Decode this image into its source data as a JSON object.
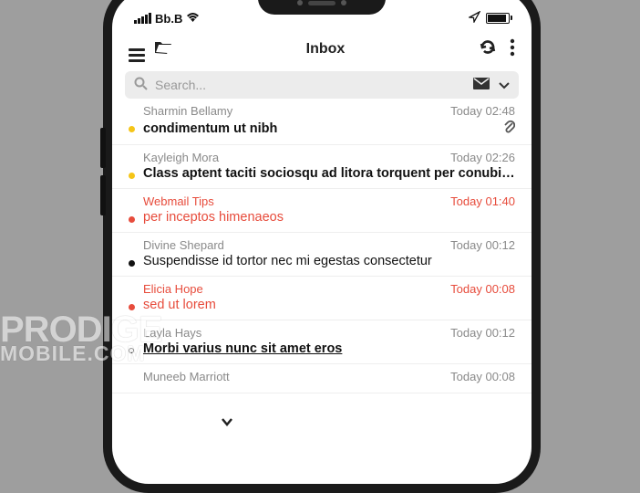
{
  "statusbar": {
    "carrier": "Bb.B"
  },
  "toolbar": {
    "title": "Inbox"
  },
  "search": {
    "placeholder": "Search..."
  },
  "emails": [
    {
      "sender": "Sharmin Bellamy",
      "time": "Today 02:48",
      "subject": "condimentum ut nibh",
      "dot": "yellow",
      "attach": true,
      "bold": true
    },
    {
      "sender": "Kayleigh Mora",
      "time": "Today 02:26",
      "subject": "Class aptent taciti sociosqu ad litora torquent per conubia n…",
      "dot": "yellow",
      "bold": true
    },
    {
      "sender": "Webmail Tips",
      "time": "Today 01:40",
      "subject": "per inceptos himenaeos",
      "dot": "solid",
      "highlight": true,
      "bold": false
    },
    {
      "sender": "Divine Shepard",
      "time": "Today 00:12",
      "subject": "Suspendisse id tortor nec mi egestas consectetur",
      "dot": "solid",
      "bold": false
    },
    {
      "sender": "Elicia Hope",
      "time": "Today 00:08",
      "subject": "sed ut lorem",
      "dot": "solid",
      "highlight": true,
      "bold": false
    },
    {
      "sender": "Layla Hays",
      "time": "Today 00:12",
      "subject": "Morbi varius nunc sit amet eros",
      "dot": "hollow",
      "bold": true,
      "underline": true
    },
    {
      "sender": "Muneeb Marriott",
      "time": "Today 00:08",
      "subject": "",
      "dot": "none",
      "bold": false
    }
  ],
  "watermark": {
    "line1": "PRODIGE",
    "line2": "MOBILE.COM"
  }
}
